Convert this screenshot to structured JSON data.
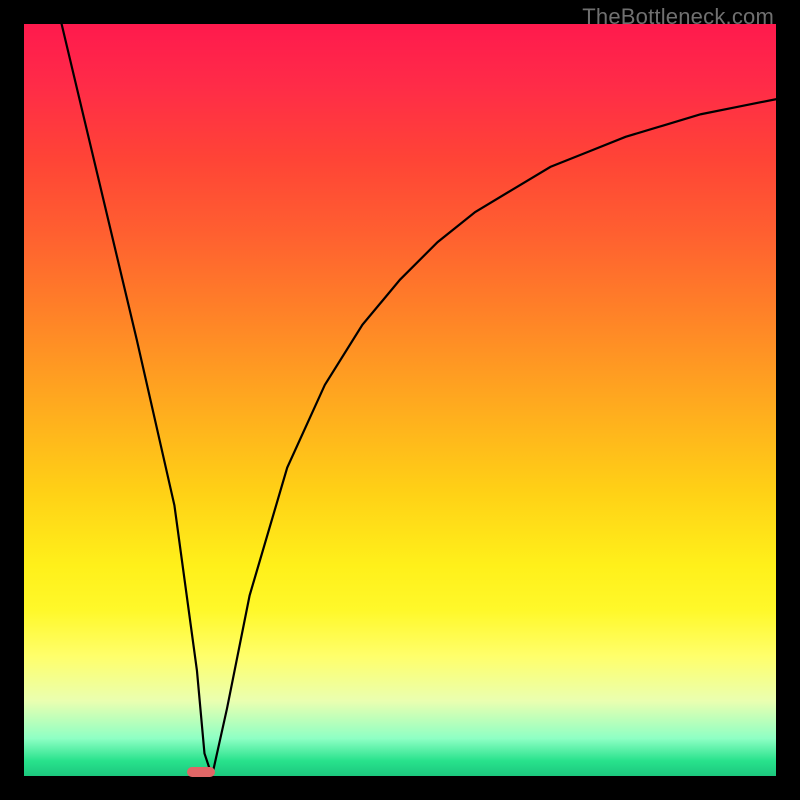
{
  "watermark": "TheBottleneck.com",
  "chart_data": {
    "type": "line",
    "title": "",
    "xlabel": "",
    "ylabel": "",
    "xlim": [
      0,
      100
    ],
    "ylim": [
      0,
      100
    ],
    "gradient_stops": [
      {
        "pos": 0,
        "color": "#ff1a4d"
      },
      {
        "pos": 0.18,
        "color": "#ff4436"
      },
      {
        "pos": 0.38,
        "color": "#ff8028"
      },
      {
        "pos": 0.62,
        "color": "#ffd016"
      },
      {
        "pos": 0.78,
        "color": "#fff82a"
      },
      {
        "pos": 0.9,
        "color": "#eaffb0"
      },
      {
        "pos": 0.98,
        "color": "#28e28c"
      },
      {
        "pos": 1.0,
        "color": "#1cc77e"
      }
    ],
    "series": [
      {
        "name": "bottleneck-curve",
        "x": [
          5,
          10,
          15,
          20,
          23,
          24,
          25,
          27,
          30,
          35,
          40,
          45,
          50,
          55,
          60,
          65,
          70,
          75,
          80,
          85,
          90,
          95,
          100
        ],
        "y": [
          100,
          79,
          58,
          36,
          14,
          3,
          0,
          9,
          24,
          41,
          52,
          60,
          66,
          71,
          75,
          78,
          81,
          83,
          85,
          86.5,
          88,
          89,
          90
        ]
      }
    ],
    "marker": {
      "name": "sweet-spot-marker",
      "x": 23.5,
      "y": 0.5,
      "color": "#e06666"
    }
  }
}
